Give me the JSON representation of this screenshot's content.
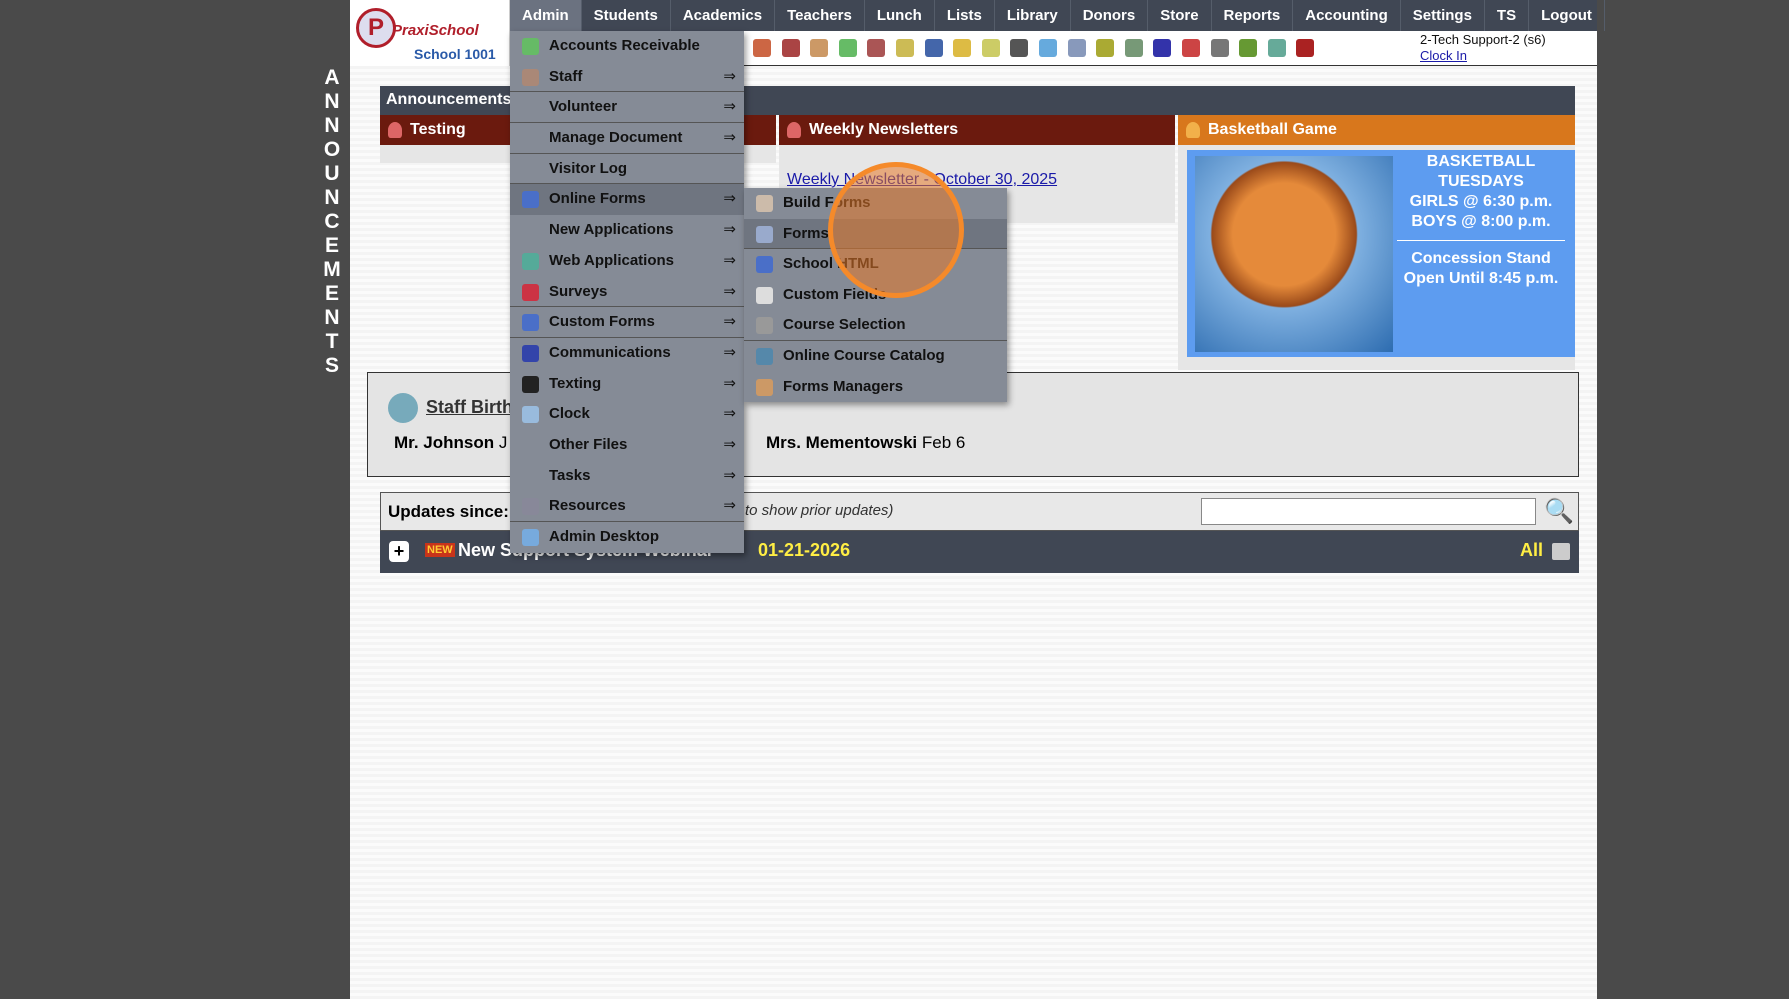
{
  "vertical_label": "ANNOUNCEMENTS",
  "logo": {
    "brand": "PraxiSchool",
    "school": "School 1001"
  },
  "nav": [
    "Admin",
    "Students",
    "Academics",
    "Teachers",
    "Lunch",
    "Lists",
    "Library",
    "Donors",
    "Store",
    "Reports",
    "Accounting",
    "Settings",
    "TS",
    "Logout"
  ],
  "user": {
    "name": "2-Tech Support-2 (s6)",
    "clock_in": "Clock In"
  },
  "announcements": {
    "title": "Announcements",
    "testing": "Testing",
    "weekly": "Weekly Newsletters",
    "newsletter_link": "Weekly Newsletter - October 30, 2025",
    "basketball": "Basketball Game"
  },
  "basketball": {
    "l1": "BASKETBALL",
    "l2": "TUESDAYS",
    "l3": "GIRLS @ 6:30 p.m.",
    "l4": "BOYS  @ 8:00 p.m.",
    "l5": "Concession Stand",
    "l6": "Open Until 8:45 p.m."
  },
  "staff": {
    "title": "Staff Birthdays",
    "p1": "Mr. Johnson",
    "p1date": "J",
    "p2": "Mrs. Mementowski",
    "p2date": "Feb 6"
  },
  "updates": {
    "label": "Updates since:",
    "hint": "to show prior updates)",
    "search_value": ""
  },
  "news": {
    "badge": "NEW",
    "title": "New Support System Webinar --",
    "date": "01-21-2026",
    "all": "All"
  },
  "admin_menu": [
    {
      "label": "Accounts Receivable",
      "arrow": "",
      "icon": "#6b6"
    },
    {
      "label": "Staff",
      "arrow": "⇒",
      "icon": "#a87",
      "sep": true
    },
    {
      "label": "Volunteer",
      "arrow": "⇒",
      "sep": true
    },
    {
      "label": "Manage Document",
      "arrow": "⇒",
      "sep": true
    },
    {
      "label": "Visitor Log",
      "arrow": "",
      "sep": true
    },
    {
      "label": "Online Forms",
      "arrow": "⇒",
      "icon": "#4a6fc8",
      "hl": true
    },
    {
      "label": "New Applications",
      "arrow": "⇒"
    },
    {
      "label": "Web Applications",
      "arrow": "⇒",
      "icon": "#5a9"
    },
    {
      "label": "Surveys",
      "arrow": "⇒",
      "icon": "#c34",
      "sep": true
    },
    {
      "label": "Custom Forms",
      "arrow": "⇒",
      "icon": "#4a6fc8",
      "sep": true
    },
    {
      "label": "Communications",
      "arrow": "⇒",
      "icon": "#34a"
    },
    {
      "label": "Texting",
      "arrow": "⇒",
      "icon": "#222"
    },
    {
      "label": "Clock",
      "arrow": "⇒",
      "icon": "#9bd"
    },
    {
      "label": "Other Files",
      "arrow": "⇒"
    },
    {
      "label": "Tasks",
      "arrow": "⇒"
    },
    {
      "label": "Resources",
      "arrow": "⇒",
      "icon": "#889",
      "sep": true
    },
    {
      "label": "Admin Desktop",
      "arrow": "",
      "icon": "#7ad"
    }
  ],
  "submenu": [
    {
      "label": "Build Forms",
      "icon": "#cba"
    },
    {
      "label": "Forms",
      "icon": "#9ac",
      "hl": true,
      "sep": true
    },
    {
      "label": "School HTML",
      "icon": "#4a6fc8"
    },
    {
      "label": "Custom Fields",
      "icon": "#ddd"
    },
    {
      "label": "Course Selection",
      "icon": "#999",
      "sep": true
    },
    {
      "label": "Online Course Catalog",
      "icon": "#58a"
    },
    {
      "label": "Forms Managers",
      "icon": "#c96"
    }
  ]
}
